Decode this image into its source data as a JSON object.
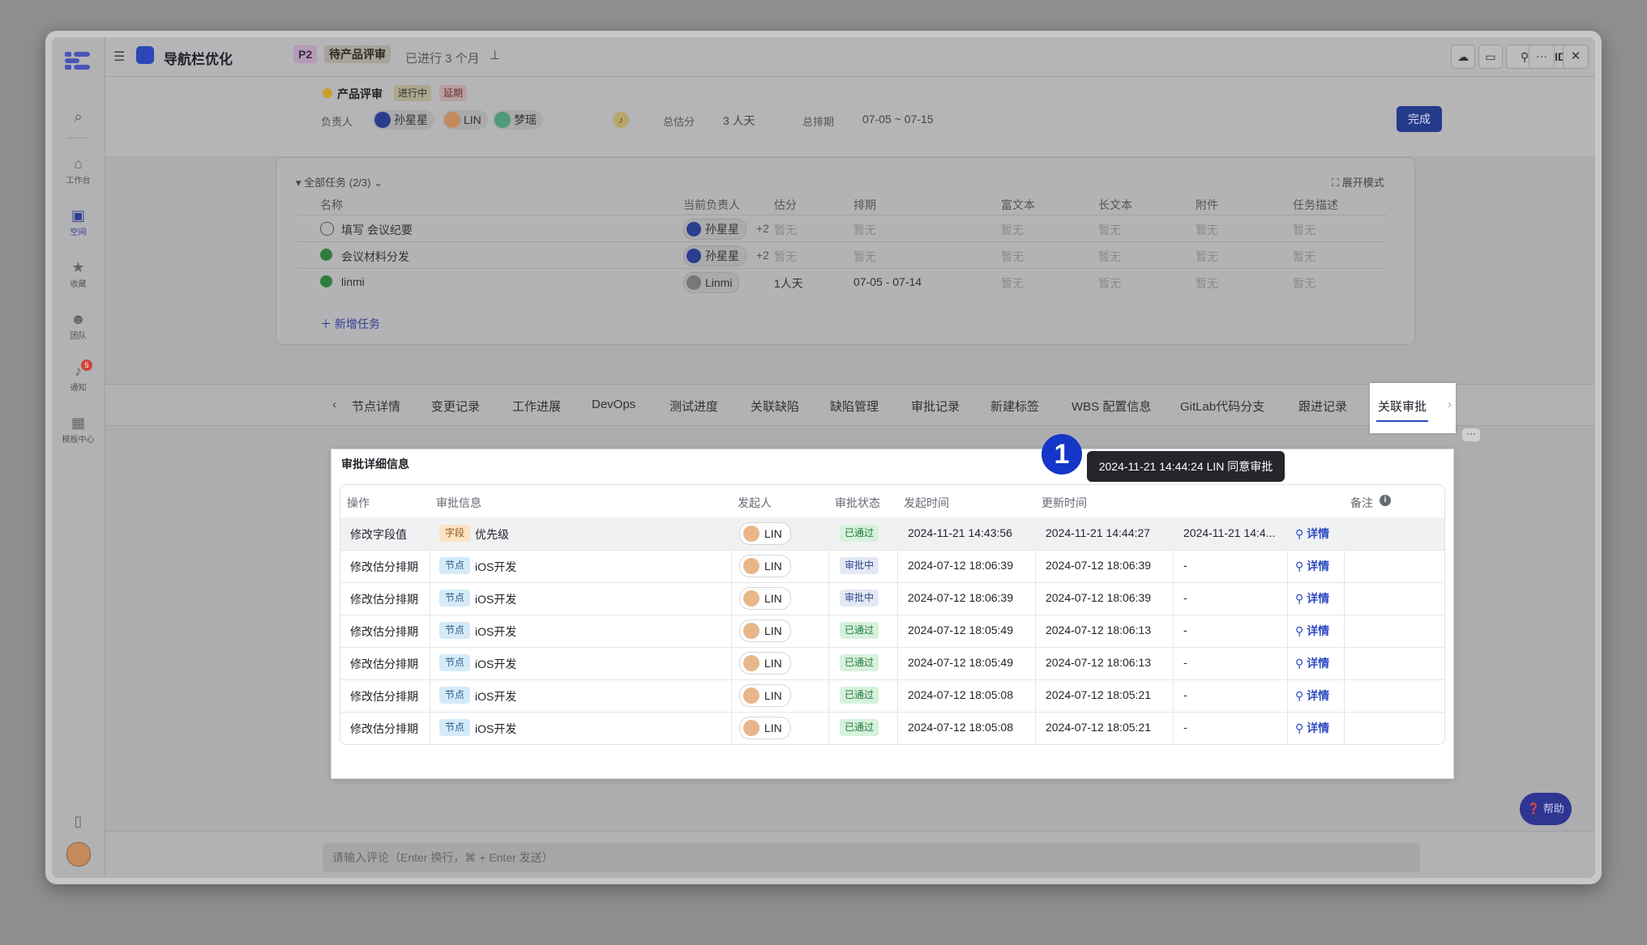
{
  "colors": {
    "accent": "#2e4bc0",
    "pass": "#1f7a3a",
    "primary_btn": "#243a8a"
  },
  "nav": {
    "items": [
      {
        "label": "",
        "icon": "search-icon"
      },
      {
        "label": "工作台",
        "icon": "home-icon"
      },
      {
        "label": "空间",
        "icon": "space-icon"
      },
      {
        "label": "收藏",
        "icon": "star-icon"
      },
      {
        "label": "团队",
        "icon": "team-icon"
      },
      {
        "label": "通知",
        "icon": "bell-icon",
        "badge": "5"
      },
      {
        "label": "模板中心",
        "icon": "grid-icon"
      }
    ]
  },
  "topbar": {
    "title": "导航栏优化",
    "priority": "P2",
    "stage": "待产品评审",
    "elapsed": "已进行 3 个月",
    "copy_id": "复制ID",
    "more": "···",
    "close": "✕"
  },
  "header": {
    "node": "产品评审",
    "status1": "进行中",
    "status2": "延期",
    "owner_label": "负责人",
    "owners": [
      "孙星星",
      "LIN",
      "梦瑶"
    ],
    "estimate_label": "总估分",
    "estimate_value": "3 人天",
    "schedule_label": "总排期",
    "schedule_value": "07-05 ~ 07-15",
    "done": "完成"
  },
  "tasks": {
    "summary": "全部任务 (2/3)",
    "expand": "展开模式",
    "columns": [
      "名称",
      "当前负责人",
      "估分",
      "排期",
      "富文本",
      "长文本",
      "附件",
      "任务描述"
    ],
    "rows": [
      {
        "name": "填写 会议纪要",
        "owner": "孙星星",
        "extra": "+2",
        "estimate": "暂无",
        "schedule": "暂无",
        "rich": "暂无",
        "long": "暂无",
        "attach": "暂无",
        "desc": "暂无",
        "done": false
      },
      {
        "name": "会议材料分发",
        "owner": "孙星星",
        "extra": "+2",
        "estimate": "暂无",
        "schedule": "暂无",
        "rich": "暂无",
        "long": "暂无",
        "attach": "暂无",
        "desc": "暂无",
        "done": true
      },
      {
        "name": "linmi",
        "owner": "Linmi",
        "extra": "",
        "estimate": "1人天",
        "schedule": "07-05 - 07-14",
        "rich": "暂无",
        "long": "暂无",
        "attach": "暂无",
        "desc": "暂无",
        "done": true
      }
    ],
    "add": "新增任务"
  },
  "tabs": [
    "节点详情",
    "变更记录",
    "工作进展",
    "DevOps",
    "测试进度",
    "关联缺陷",
    "缺陷管理",
    "审批记录",
    "新建标签",
    "WBS 配置信息",
    "GitLab代码分支",
    "跟进记录",
    "关联审批"
  ],
  "approval": {
    "title": "审批详细信息",
    "columns": [
      "操作",
      "审批信息",
      "发起人",
      "审批状态",
      "发起时间",
      "更新时间",
      "",
      "",
      "备注"
    ],
    "rows": [
      {
        "op": "修改字段值",
        "tag": "字段",
        "info": "优先级",
        "user": "LIN",
        "status": "已通过",
        "start": "2024-11-21 14:43:56",
        "update": "2024-11-21 14:44:27",
        "finish": "2024-11-21 14:4...",
        "link": "详情"
      },
      {
        "op": "修改估分排期",
        "tag": "节点",
        "info": "iOS开发",
        "user": "LIN",
        "status": "审批中",
        "start": "2024-07-12 18:06:39",
        "update": "2024-07-12 18:06:39",
        "finish": "-",
        "link": "详情"
      },
      {
        "op": "修改估分排期",
        "tag": "节点",
        "info": "iOS开发",
        "user": "LIN",
        "status": "审批中",
        "start": "2024-07-12 18:06:39",
        "update": "2024-07-12 18:06:39",
        "finish": "-",
        "link": "详情"
      },
      {
        "op": "修改估分排期",
        "tag": "节点",
        "info": "iOS开发",
        "user": "LIN",
        "status": "已通过",
        "start": "2024-07-12 18:05:49",
        "update": "2024-07-12 18:06:13",
        "finish": "-",
        "link": "详情"
      },
      {
        "op": "修改估分排期",
        "tag": "节点",
        "info": "iOS开发",
        "user": "LIN",
        "status": "已通过",
        "start": "2024-07-12 18:05:49",
        "update": "2024-07-12 18:06:13",
        "finish": "-",
        "link": "详情"
      },
      {
        "op": "修改估分排期",
        "tag": "节点",
        "info": "iOS开发",
        "user": "LIN",
        "status": "已通过",
        "start": "2024-07-12 18:05:08",
        "update": "2024-07-12 18:05:21",
        "finish": "-",
        "link": "详情"
      },
      {
        "op": "修改估分排期",
        "tag": "节点",
        "info": "iOS开发",
        "user": "LIN",
        "status": "已通过",
        "start": "2024-07-12 18:05:08",
        "update": "2024-07-12 18:05:21",
        "finish": "-",
        "link": "详情"
      }
    ],
    "tooltip": "2024-11-21 14:44:24 LIN 同意审批",
    "marker": "1"
  },
  "comment": {
    "placeholder": "请输入评论（Enter 换行，⌘ + Enter 发送）"
  },
  "help": "帮助"
}
